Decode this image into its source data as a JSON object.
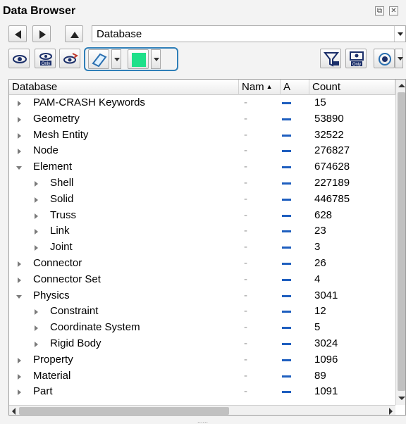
{
  "window": {
    "title": "Data Browser",
    "restore_glyph": "⧉",
    "close_glyph": "✕"
  },
  "nav": {
    "path_value": "Database"
  },
  "columns": [
    {
      "label": "Database"
    },
    {
      "label": "Nam",
      "sort": "▲"
    },
    {
      "label": "A"
    },
    {
      "label": "Count"
    }
  ],
  "rows": [
    {
      "label": "PAM-CRASH Keywords",
      "level": 0,
      "state": "closed",
      "nam": "-",
      "count": "15"
    },
    {
      "label": "Geometry",
      "level": 0,
      "state": "closed",
      "nam": "-",
      "count": "53890"
    },
    {
      "label": "Mesh Entity",
      "level": 0,
      "state": "closed",
      "nam": "-",
      "count": "32522"
    },
    {
      "label": "Node",
      "level": 0,
      "state": "closed",
      "nam": "-",
      "count": "276827"
    },
    {
      "label": "Element",
      "level": 0,
      "state": "open",
      "nam": "-",
      "count": "674628"
    },
    {
      "label": "Shell",
      "level": 1,
      "state": "closed",
      "nam": "-",
      "count": "227189"
    },
    {
      "label": "Solid",
      "level": 1,
      "state": "closed",
      "nam": "-",
      "count": "446785"
    },
    {
      "label": "Truss",
      "level": 1,
      "state": "closed",
      "nam": "-",
      "count": "628"
    },
    {
      "label": "Link",
      "level": 1,
      "state": "closed",
      "nam": "-",
      "count": "23"
    },
    {
      "label": "Joint",
      "level": 1,
      "state": "closed",
      "nam": "-",
      "count": "3"
    },
    {
      "label": "Connector",
      "level": 0,
      "state": "closed",
      "nam": "-",
      "count": "26"
    },
    {
      "label": "Connector Set",
      "level": 0,
      "state": "closed",
      "nam": "-",
      "count": "4"
    },
    {
      "label": "Physics",
      "level": 0,
      "state": "open",
      "nam": "-",
      "count": "3041"
    },
    {
      "label": "Constraint",
      "level": 1,
      "state": "closed",
      "nam": "-",
      "count": "12"
    },
    {
      "label": "Coordinate System",
      "level": 1,
      "state": "closed",
      "nam": "-",
      "count": "5"
    },
    {
      "label": "Rigid Body",
      "level": 1,
      "state": "closed",
      "nam": "-",
      "count": "3024"
    },
    {
      "label": "Property",
      "level": 0,
      "state": "closed",
      "nam": "-",
      "count": "1096"
    },
    {
      "label": "Material",
      "level": 0,
      "state": "closed",
      "nam": "-",
      "count": "89"
    },
    {
      "label": "Part",
      "level": 0,
      "state": "closed",
      "nam": "-",
      "count": "1091"
    }
  ],
  "colors": {
    "accent": "#2f7fb8",
    "color_swatch": "#1ee08a",
    "a_dash": "#1f5fbf"
  },
  "icons": [
    "back-icon",
    "forward-icon",
    "up-icon",
    "eye-icon",
    "eye-only-icon",
    "eye-toggle-icon",
    "rubber-icon",
    "filter-icon",
    "display-only-icon",
    "radio-view-icon"
  ],
  "status": {
    "grip": "......"
  }
}
